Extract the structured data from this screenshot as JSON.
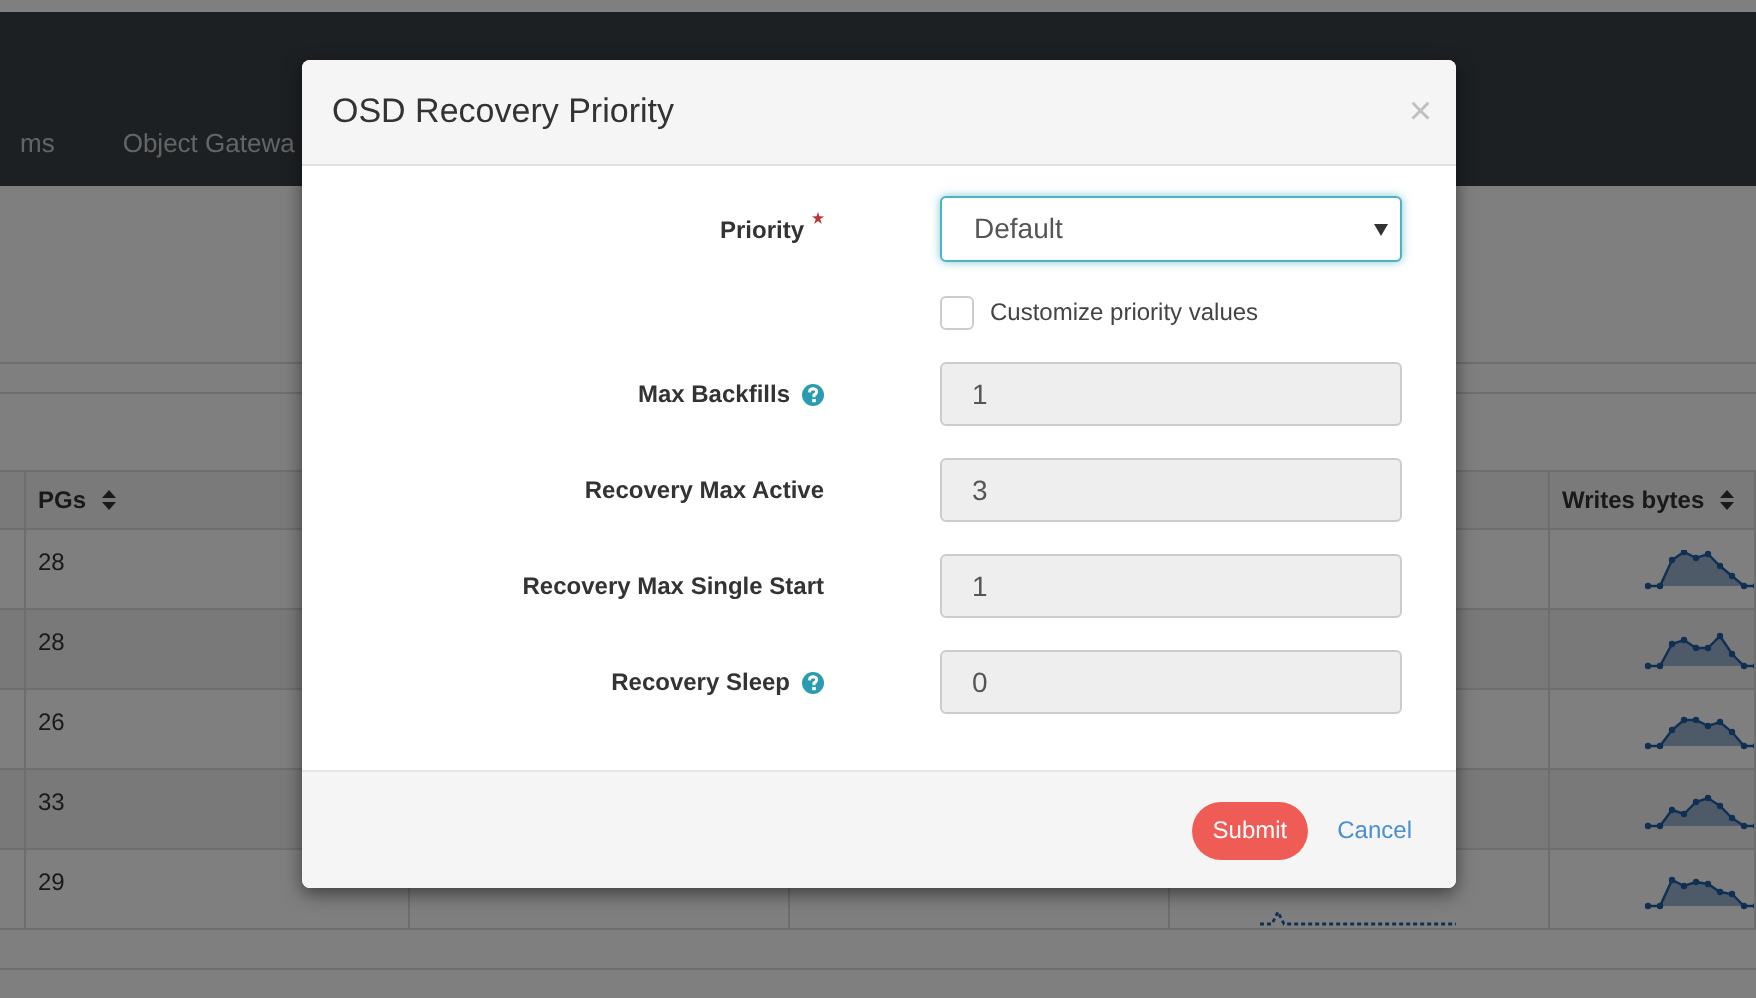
{
  "navbar": {
    "items": [
      {
        "label": "ms"
      },
      {
        "label": "Object Gatewa"
      }
    ]
  },
  "table": {
    "columns": [
      {
        "label": "PGs",
        "sortable": true
      },
      {
        "label": "Writes bytes",
        "sortable": true
      }
    ],
    "rows": [
      {
        "pgs": "28"
      },
      {
        "pgs": "28"
      },
      {
        "pgs": "26"
      },
      {
        "pgs": "33"
      },
      {
        "pgs": "29"
      }
    ]
  },
  "modal": {
    "title": "OSD Recovery Priority",
    "close": "×",
    "priority": {
      "label": "Priority",
      "required": true,
      "value": "Default",
      "focused": true
    },
    "customize": {
      "label": "Customize priority values",
      "checked": false
    },
    "fields": [
      {
        "label": "Max Backfills",
        "help": true,
        "value": "1",
        "disabled": true
      },
      {
        "label": "Recovery Max Active",
        "help": false,
        "value": "3",
        "disabled": true
      },
      {
        "label": "Recovery Max Single Start",
        "help": false,
        "value": "1",
        "disabled": true
      },
      {
        "label": "Recovery Sleep",
        "help": true,
        "value": "0",
        "disabled": true
      }
    ],
    "buttons": {
      "submit": "Submit",
      "cancel": "Cancel"
    }
  }
}
